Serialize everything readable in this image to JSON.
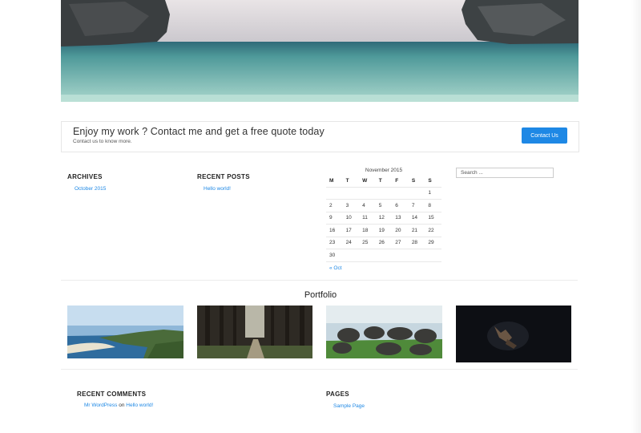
{
  "cta": {
    "title": "Enjoy my work ? Contact me and get a free quote today",
    "subtitle": "Contact us to know more.",
    "button": "Contact Us"
  },
  "archives": {
    "title": "ARCHIVES",
    "items": [
      "October 2015"
    ]
  },
  "recent_posts": {
    "title": "RECENT POSTS",
    "items": [
      "Hello world!"
    ]
  },
  "calendar": {
    "caption": "November 2015",
    "weekdays": [
      "M",
      "T",
      "W",
      "T",
      "F",
      "S",
      "S"
    ],
    "weeks": [
      [
        "",
        "",
        "",
        "",
        "",
        "",
        "1"
      ],
      [
        "2",
        "3",
        "4",
        "5",
        "6",
        "7",
        "8"
      ],
      [
        "9",
        "10",
        "11",
        "12",
        "13",
        "14",
        "15"
      ],
      [
        "16",
        "17",
        "18",
        "19",
        "20",
        "21",
        "22"
      ],
      [
        "23",
        "24",
        "25",
        "26",
        "27",
        "28",
        "29"
      ],
      [
        "30",
        "",
        "",
        "",
        "",
        "",
        ""
      ]
    ],
    "prev": "« Oct"
  },
  "search": {
    "placeholder": "Search ..."
  },
  "portfolio": {
    "title": "Portfolio"
  },
  "recent_comments": {
    "title": "RECENT COMMENTS",
    "author": "Mr WordPress",
    "connector": "on",
    "post": "Hello world!"
  },
  "pages": {
    "title": "PAGES",
    "items": [
      "Sample Page"
    ]
  },
  "colors": {
    "accent": "#1e88e5"
  }
}
